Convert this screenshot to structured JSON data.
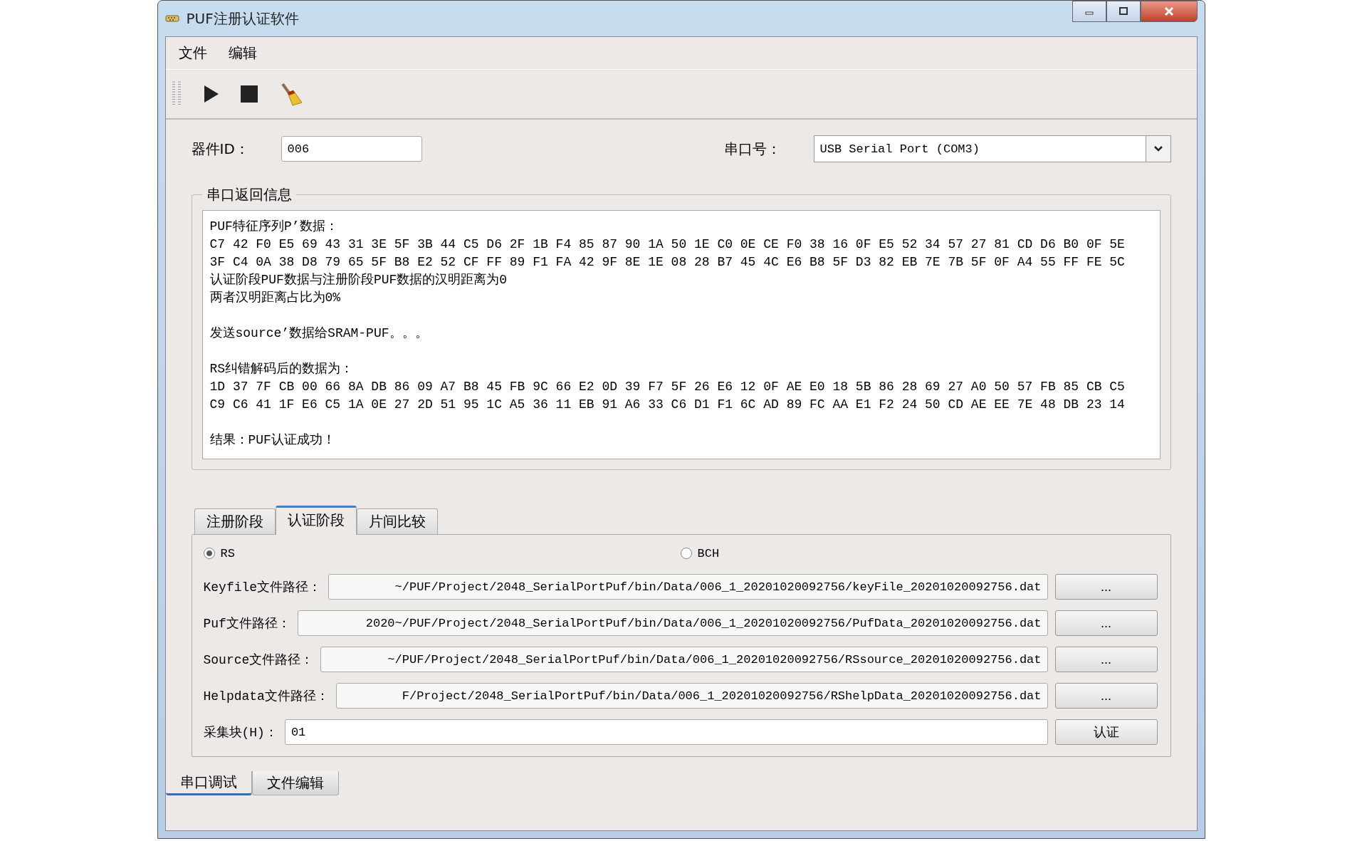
{
  "window": {
    "title": "PUF注册认证软件"
  },
  "menu": [
    "文件",
    "编辑"
  ],
  "device_id": {
    "label": "器件ID：",
    "value": "006"
  },
  "serial_port": {
    "label": "串口号：",
    "value": "USB Serial Port (COM3)"
  },
  "serial_output": {
    "title": "串口返回信息",
    "blocks": [
      [
        "PUF特征序列P’数据：",
        "C7 42 F0 E5 69 43 31 3E 5F 3B 44 C5 D6 2F 1B F4 85 87 90 1A 50 1E C0 0E CE F0 38 16 0F E5 52 34 57 27 81 CD D6 B0 0F 5E",
        "3F C4 0A 38 D8 79 65 5F B8 E2 52 CF FF 89 F1 FA 42 9F 8E 1E 08 28 B7 45 4C E6 B8 5F D3 82 EB 7E 7B 5F 0F A4 55 FF FE 5C",
        "认证阶段PUF数据与注册阶段PUF数据的汉明距离为0",
        "两者汉明距离占比为0%"
      ],
      [
        "发送source’数据给SRAM-PUF。。。"
      ],
      [
        "RS纠错解码后的数据为：",
        "1D 37 7F CB 00 66 8A DB 86 09 A7 B8 45 FB 9C 66 E2 0D 39 F7 5F 26 E6 12 0F AE E0 18 5B 86 28 69 27 A0 50 57 FB 85 CB C5",
        "C9 C6 41 1F E6 C5 1A 0E 27 2D 51 95 1C A5 36 11 EB 91 A6 33 C6 D1 F1 6C AD 89 FC AA E1 F2 24 50 CD AE EE 7E 48 DB 23 14"
      ],
      [
        "结果：PUF认证成功！"
      ]
    ]
  },
  "stage_tabs": [
    {
      "label": "注册阶段",
      "selected": false
    },
    {
      "label": "认证阶段",
      "selected": true
    },
    {
      "label": "片间比较",
      "selected": false
    }
  ],
  "decoders": [
    {
      "label": "RS",
      "selected": true
    },
    {
      "label": "BCH",
      "selected": false
    }
  ],
  "file_rows": [
    {
      "label": "Keyfile文件路径：",
      "value": "~/PUF/Project/2048_SerialPortPuf/bin/Data/006_1_20201020092756/keyFile_20201020092756.dat",
      "button": "..."
    },
    {
      "label": "Puf文件路径：",
      "value": "2020~/PUF/Project/2048_SerialPortPuf/bin/Data/006_1_20201020092756/PufData_20201020092756.dat",
      "button": "..."
    },
    {
      "label": "Source文件路径：",
      "value": "~/PUF/Project/2048_SerialPortPuf/bin/Data/006_1_20201020092756/RSsource_20201020092756.dat",
      "button": "..."
    },
    {
      "label": "Helpdata文件路径：",
      "value": "F/Project/2048_SerialPortPuf/bin/Data/006_1_20201020092756/RShelpData_20201020092756.dat",
      "button": "..."
    },
    {
      "label": "采集块(H)：",
      "value": "01",
      "button": "认证"
    }
  ],
  "bottom_tabs": [
    {
      "label": "串口调试",
      "selected": true
    },
    {
      "label": "文件编辑",
      "selected": false
    }
  ]
}
